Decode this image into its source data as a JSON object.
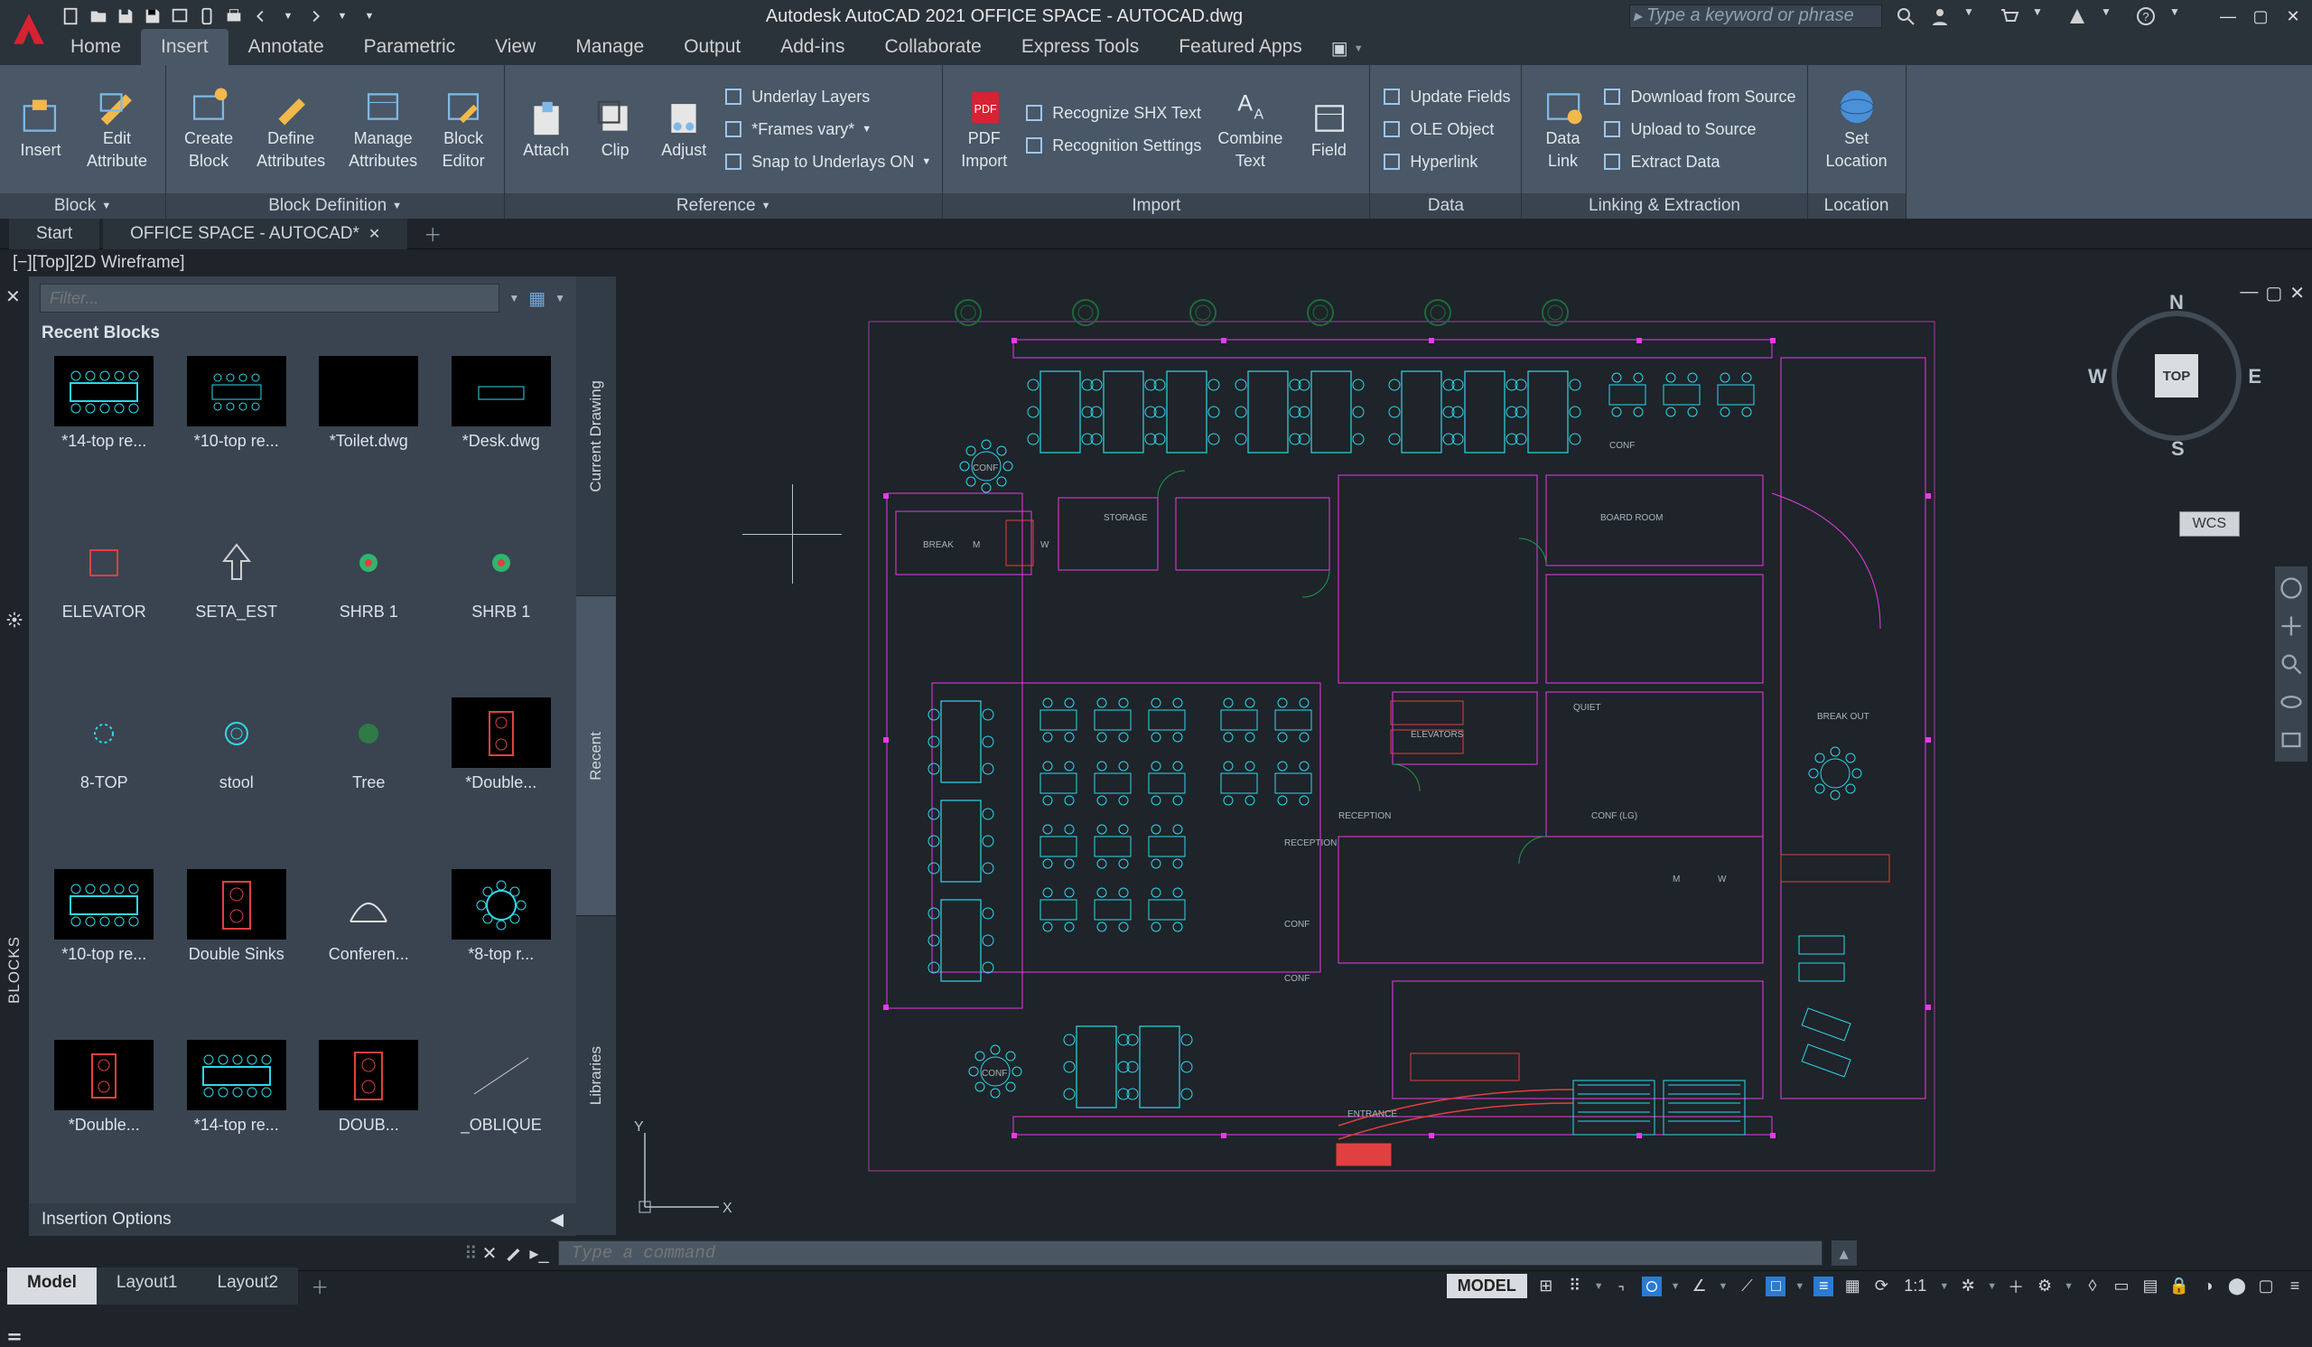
{
  "title": "Autodesk AutoCAD 2021   OFFICE SPACE - AUTOCAD.dwg",
  "search_placeholder": "Type a keyword or phrase",
  "menu_tabs": [
    "Home",
    "Insert",
    "Annotate",
    "Parametric",
    "View",
    "Manage",
    "Output",
    "Add-ins",
    "Collaborate",
    "Express Tools",
    "Featured Apps"
  ],
  "menu_active_index": 1,
  "ribbon": {
    "panels": [
      {
        "label": "Block",
        "dropdown": true,
        "big": [
          {
            "name": "insert",
            "lines": [
              "Insert"
            ]
          },
          {
            "name": "edit-attribute",
            "lines": [
              "Edit",
              "Attribute"
            ]
          }
        ]
      },
      {
        "label": "Block Definition",
        "dropdown": true,
        "big": [
          {
            "name": "create-block",
            "lines": [
              "Create",
              "Block"
            ]
          },
          {
            "name": "define-attributes",
            "lines": [
              "Define",
              "Attributes"
            ]
          },
          {
            "name": "manage-attributes",
            "lines": [
              "Manage",
              "Attributes"
            ]
          },
          {
            "name": "block-editor",
            "lines": [
              "Block",
              "Editor"
            ]
          }
        ]
      },
      {
        "label": "Reference",
        "dropdown": true,
        "big": [
          {
            "name": "attach",
            "lines": [
              "Attach"
            ]
          },
          {
            "name": "clip",
            "lines": [
              "Clip"
            ]
          },
          {
            "name": "adjust",
            "lines": [
              "Adjust"
            ]
          }
        ],
        "rows": [
          {
            "name": "underlay-layers",
            "label": "Underlay Layers"
          },
          {
            "name": "frames-vary",
            "label": "*Frames vary*",
            "dd": true
          },
          {
            "name": "snap-underlays",
            "label": "Snap to Underlays ON",
            "dd": true
          }
        ]
      },
      {
        "label": "Import",
        "big": [
          {
            "name": "pdf-import",
            "lines": [
              "PDF",
              "Import"
            ]
          }
        ],
        "rows": [
          {
            "name": "recognize-shx",
            "label": "Recognize SHX Text"
          },
          {
            "name": "recognition-settings",
            "label": "Recognition Settings"
          }
        ],
        "big2": [
          {
            "name": "combine-text",
            "lines": [
              "Combine",
              "Text"
            ]
          },
          {
            "name": "field",
            "lines": [
              "Field"
            ]
          }
        ]
      },
      {
        "label": "Data",
        "rows": [
          {
            "name": "update-fields",
            "label": "Update Fields"
          },
          {
            "name": "ole-object",
            "label": "OLE Object"
          },
          {
            "name": "hyperlink",
            "label": "Hyperlink"
          }
        ]
      },
      {
        "label": "Linking & Extraction",
        "big": [
          {
            "name": "data-link",
            "lines": [
              "Data",
              "Link"
            ]
          }
        ],
        "rows": [
          {
            "name": "download-source",
            "label": "Download from Source"
          },
          {
            "name": "upload-source",
            "label": "Upload to Source"
          },
          {
            "name": "extract-data",
            "label": "Extract  Data"
          }
        ]
      },
      {
        "label": "Location",
        "big": [
          {
            "name": "set-location",
            "lines": [
              "Set",
              "Location"
            ]
          }
        ]
      }
    ]
  },
  "file_tabs": [
    {
      "label": "Start",
      "close": false
    },
    {
      "label": "OFFICE SPACE - AUTOCAD*",
      "close": true,
      "active": true
    }
  ],
  "view_label": "[−][Top][2D Wireframe]",
  "palette": {
    "title": "BLOCKS",
    "filter_placeholder": "Filter...",
    "section": "Recent Blocks",
    "tabs": [
      "Current Drawing",
      "Recent",
      "Libraries"
    ],
    "tab_active": 1,
    "footer": "Insertion Options",
    "blocks": [
      {
        "name": "*14-top re...",
        "kind": "table-cyan"
      },
      {
        "name": "*10-top re...",
        "kind": "table-cyan-small"
      },
      {
        "name": "*Toilet.dwg",
        "kind": "blank"
      },
      {
        "name": "*Desk.dwg",
        "kind": "desk"
      },
      {
        "name": "ELEVATOR",
        "kind": "elevator",
        "light": true
      },
      {
        "name": "SETA_EST",
        "kind": "arrow-up",
        "light": true
      },
      {
        "name": "SHRB 1",
        "kind": "shrub",
        "light": true
      },
      {
        "name": "SHRB 1",
        "kind": "shrub",
        "light": true
      },
      {
        "name": "8-TOP",
        "kind": "eight-top",
        "light": true
      },
      {
        "name": "stool",
        "kind": "stool",
        "light": true
      },
      {
        "name": "Tree",
        "kind": "tree",
        "light": true
      },
      {
        "name": "*Double...",
        "kind": "double-red"
      },
      {
        "name": "*10-top re...",
        "kind": "table-cyan"
      },
      {
        "name": "Double Sinks",
        "kind": "sinks-red"
      },
      {
        "name": "Conferen...",
        "kind": "conf-white",
        "light": true
      },
      {
        "name": "*8-top r...",
        "kind": "eight-round"
      },
      {
        "name": "*Double...",
        "kind": "double-red"
      },
      {
        "name": "*14-top re...",
        "kind": "table-cyan"
      },
      {
        "name": "DOUB...",
        "kind": "sinks-red"
      },
      {
        "name": "_OBLIQUE",
        "kind": "oblique",
        "light": true
      }
    ]
  },
  "viewcube": {
    "face": "TOP",
    "dirs": {
      "n": "N",
      "s": "S",
      "e": "E",
      "w": "W"
    },
    "wcs": "WCS"
  },
  "floorplan_labels": [
    "CONF",
    "STORAGE",
    "BREAK",
    "M",
    "W",
    "CONF",
    "BOARD ROOM",
    "ELEVATORS",
    "RECEPTION",
    "RECEPTION",
    "CONF (LG)",
    "BREAK OUT",
    "QUIET",
    "CONF",
    "CONF",
    "CONF",
    "M",
    "W",
    "ENTRANCE"
  ],
  "cmd_placeholder": "Type a command",
  "layout_tabs": [
    "Model",
    "Layout1",
    "Layout2"
  ],
  "layout_active": 0,
  "status": {
    "model": "MODEL",
    "scale": "1:1"
  }
}
